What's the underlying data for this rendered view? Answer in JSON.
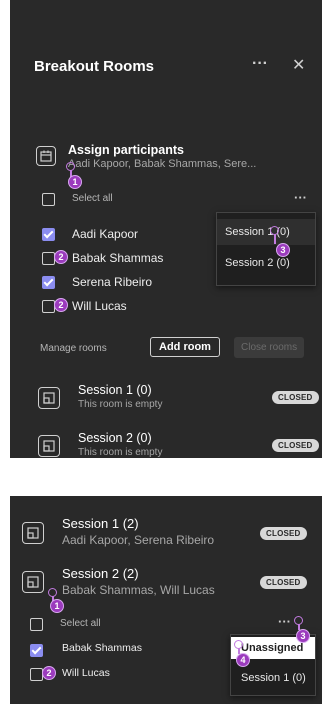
{
  "panel_top": {
    "title": "Breakout Rooms",
    "more_icon": "ellipsis-icon",
    "close_icon": "close-icon",
    "assign": {
      "title": "Assign participants",
      "subtitle": "Aadi Kapoor, Babak Shammas, Sere...",
      "icon": "calendar-people-icon"
    },
    "select_all": "Select all",
    "participants": [
      {
        "name": "Aadi Kapoor",
        "checked": true
      },
      {
        "name": "Babak Shammas",
        "checked": false
      },
      {
        "name": "Serena Ribeiro",
        "checked": true
      },
      {
        "name": "Will Lucas",
        "checked": false
      }
    ],
    "menu": [
      "Session 1 (0)",
      "Session 2 (0)"
    ],
    "manage_rooms": "Manage rooms",
    "add_room": "Add room",
    "close_rooms": "Close rooms",
    "rooms": [
      {
        "name": "Session 1 (0)",
        "detail": "This room is empty",
        "status": "CLOSED"
      },
      {
        "name": "Session 2 (0)",
        "detail": "This room is empty",
        "status": "CLOSED"
      }
    ],
    "markers": [
      "1",
      "2",
      "2",
      "3"
    ]
  },
  "panel_bottom": {
    "rooms": [
      {
        "name": "Session 1 (2)",
        "detail": "Aadi Kapoor, Serena Ribeiro",
        "status": "CLOSED"
      },
      {
        "name": "Session 2 (2)",
        "detail": "Babak Shammas, Will Lucas",
        "status": "CLOSED"
      }
    ],
    "select_all": "Select all",
    "participants": [
      {
        "name": "Babak Shammas",
        "checked": true
      },
      {
        "name": "Will Lucas",
        "checked": false
      }
    ],
    "menu": [
      "Unassigned",
      "Session 1 (0)"
    ],
    "markers": [
      "1",
      "2",
      "3",
      "4"
    ]
  },
  "colors": {
    "panel_bg": "#292929",
    "accent": "#8b8df0",
    "marker": "#9b3bbd"
  }
}
